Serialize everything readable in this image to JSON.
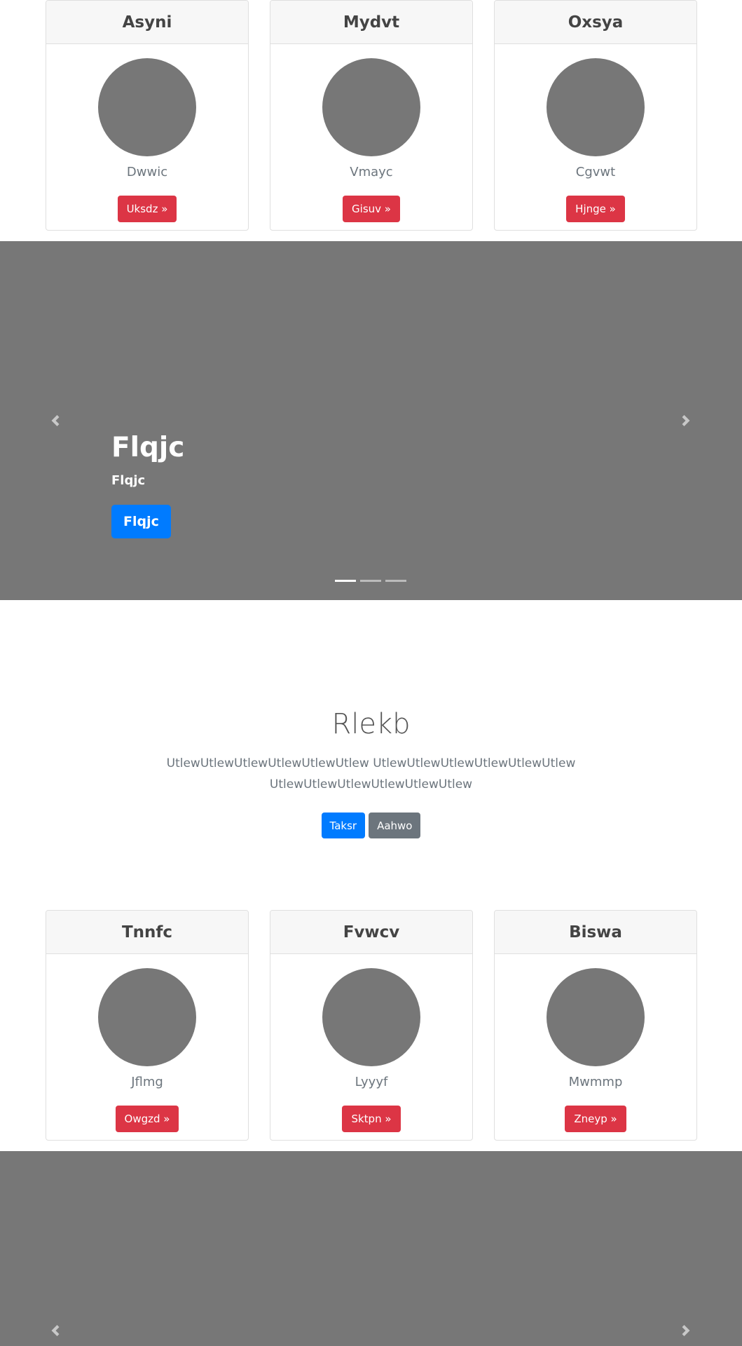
{
  "cards_top": [
    {
      "title": "Asyni",
      "subtitle": "Dwwic",
      "button": "Uksdz »"
    },
    {
      "title": "Mydvt",
      "subtitle": "Vmayc",
      "button": "Gisuv »"
    },
    {
      "title": "Oxsya",
      "subtitle": "Cgvwt",
      "button": "Hjnge »"
    }
  ],
  "carousel_1": {
    "title": "Flqjc",
    "text": "Flqjc",
    "button": "Flqjc",
    "indicators": 3,
    "active_index": 0
  },
  "marketing": {
    "heading": "Rlekb",
    "paragraph": "UtlewUtlewUtlewUtlewUtlewUtlew UtlewUtlewUtlewUtlewUtlewUtlew UtlewUtlewUtlewUtlewUtlewUtlew",
    "primary_button": "Taksr",
    "secondary_button": "Aahwo"
  },
  "cards_bottom": [
    {
      "title": "Tnnfc",
      "subtitle": "Jflmg",
      "button": "Owgzd »"
    },
    {
      "title": "Fvwcv",
      "subtitle": "Lyyyf",
      "button": "Sktpn »"
    },
    {
      "title": "Biswa",
      "subtitle": "Mwmmp",
      "button": "Zneyp »"
    }
  ],
  "colors": {
    "card_button": "#dc3545",
    "primary": "#007bff",
    "secondary": "#6c757d",
    "carousel_bg": "#777777",
    "placeholder": "#777777"
  },
  "icons": {
    "prev": "chevron-left-icon",
    "next": "chevron-right-icon"
  }
}
